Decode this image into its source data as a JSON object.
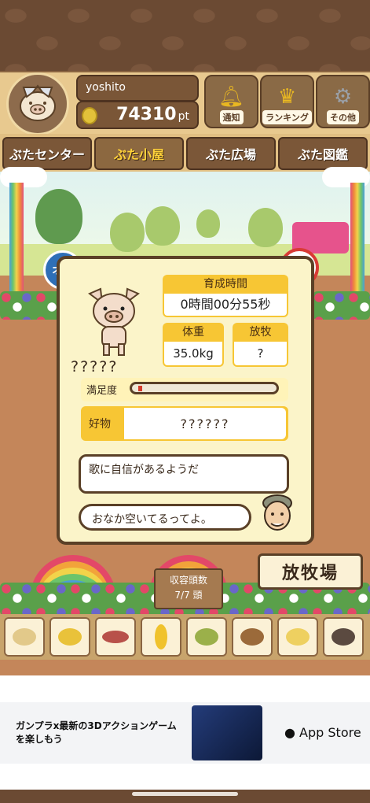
{
  "user": {
    "name": "yoshito",
    "points": "74310",
    "points_unit": "pt"
  },
  "top_buttons": [
    {
      "label": "通知",
      "icon": "bell-icon"
    },
    {
      "label": "ランキング",
      "icon": "crown-icon"
    },
    {
      "label": "その他",
      "icon": "gear-icon"
    }
  ],
  "tabs": [
    {
      "label": "ぶたセンター",
      "active": false
    },
    {
      "label": "ぶた小屋",
      "active": true
    },
    {
      "label": "ぶた広場",
      "active": false
    },
    {
      "label": "ぶた図鑑",
      "active": false
    }
  ],
  "pig": {
    "gender_label": "オス",
    "name": "?????",
    "growth_time_label": "育成時間",
    "growth_time_value": "0時間00分55秒",
    "weight_label": "体重",
    "weight_value": "35.0kg",
    "grazing_label": "放牧",
    "grazing_value": "?",
    "satisfaction_label": "満足度",
    "satisfaction_level": 0.03,
    "favorite_label": "好物",
    "favorite_value": "??????",
    "message": "歌に自信があるようだ",
    "farmer_message": "おなか空いてるってよ。"
  },
  "capacity": {
    "label": "収容頭数",
    "value": "7/7 頭"
  },
  "pasture_button": "放牧場",
  "feeds": [
    "beans",
    "corn-kernels",
    "sweet-potato",
    "corn",
    "green-beans",
    "acorns",
    "rice",
    "truffle"
  ],
  "ad": {
    "text": "ガンプラx最新の3Dアクションゲームを楽しもう",
    "store": "App Store"
  },
  "colors": {
    "accent_yellow": "#f7c634",
    "wood": "#7a5637",
    "male_blue": "#2e6fb7",
    "alert_red": "#d93a35"
  }
}
